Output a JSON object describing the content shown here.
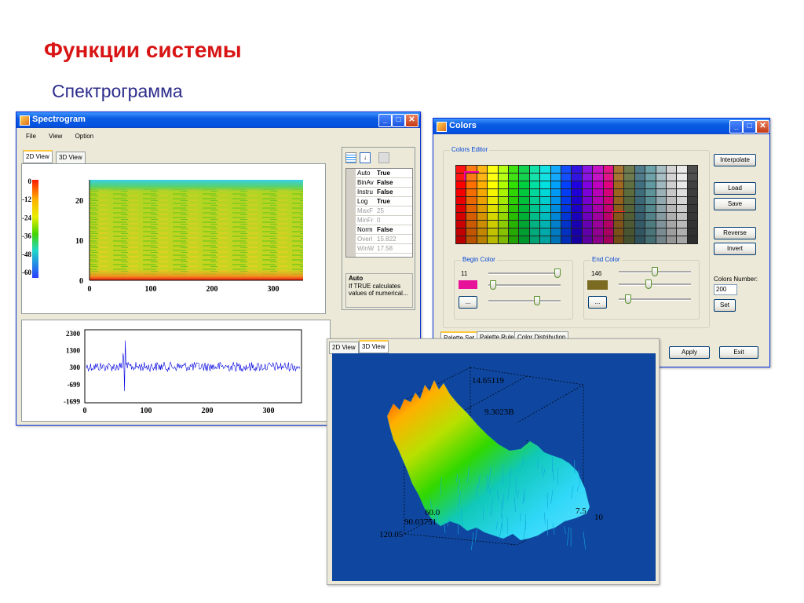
{
  "slide": {
    "title": "Функции системы",
    "subtitle": "Спектрограмма"
  },
  "spectrogram_window": {
    "title": "Spectrogram",
    "menu": [
      "File",
      "View",
      "Option"
    ],
    "tabs": [
      "2D View",
      "3D View"
    ],
    "colorbar_ticks": [
      "0",
      "-12",
      "-24",
      "-36",
      "-48",
      "-60"
    ],
    "spec_y_ticks": [
      "20",
      "10",
      "0"
    ],
    "spec_x_ticks": [
      "0",
      "100",
      "200",
      "300"
    ],
    "wave_y_ticks": [
      "2300",
      "1300",
      "300",
      "-699",
      "-1699"
    ],
    "wave_x_ticks": [
      "0",
      "100",
      "200",
      "300"
    ],
    "properties": [
      {
        "name": "Auto",
        "value": "True",
        "enabled": true
      },
      {
        "name": "BinAv",
        "value": "False",
        "enabled": true
      },
      {
        "name": "Instru",
        "value": "False",
        "enabled": true
      },
      {
        "name": "Log",
        "value": "True",
        "enabled": true
      },
      {
        "name": "MaxF",
        "value": "25",
        "enabled": false
      },
      {
        "name": "MinFr",
        "value": "0",
        "enabled": false
      },
      {
        "name": "Norm",
        "value": "False",
        "enabled": true
      },
      {
        "name": "Overl",
        "value": "15.822",
        "enabled": false
      },
      {
        "name": "WinW",
        "value": "17.58",
        "enabled": false
      }
    ],
    "help_title": "Auto",
    "help_text": "If TRUE calculates values of numerical..."
  },
  "colors_window": {
    "title": "Colors",
    "editor_label": "Colors Editor",
    "buttons": {
      "interpolate": "Interpolate",
      "load": "Load",
      "save": "Save",
      "reverse": "Reverse",
      "invert": "Invert",
      "set": "Set",
      "apply": "Apply",
      "exit": "Exit",
      "begin_more": "...",
      "end_more": "..."
    },
    "begin": {
      "label": "Begin Color",
      "value": "11",
      "swatch": "#e8129a"
    },
    "end": {
      "label": "End Color",
      "value": "146",
      "swatch": "#7a6a22"
    },
    "colors_number_label": "Colors Number:",
    "colors_number_value": "200",
    "tabs": [
      "Palette Set",
      "Palette Rule",
      "Color Distribution"
    ],
    "palette_columns": [
      "#ff0000",
      "#ff7000",
      "#ffb000",
      "#ffff00",
      "#b0ff00",
      "#30e000",
      "#00d040",
      "#00e0a0",
      "#00e0e0",
      "#00a0ff",
      "#0040ff",
      "#2000e0",
      "#8000e0",
      "#c000c0",
      "#e00080",
      "#a06820",
      "#607040",
      "#407080",
      "#609aa0",
      "#a0b8c0",
      "#d0d0d0",
      "#e8e8e8",
      "#404040"
    ]
  },
  "view3d": {
    "tabs": [
      "2D View",
      "3D View"
    ],
    "labels": [
      "14.65119",
      "9.3023B",
      "60.0",
      "90.03751",
      "120.05",
      "7.5",
      "10"
    ],
    "background": "#0f47a0"
  }
}
